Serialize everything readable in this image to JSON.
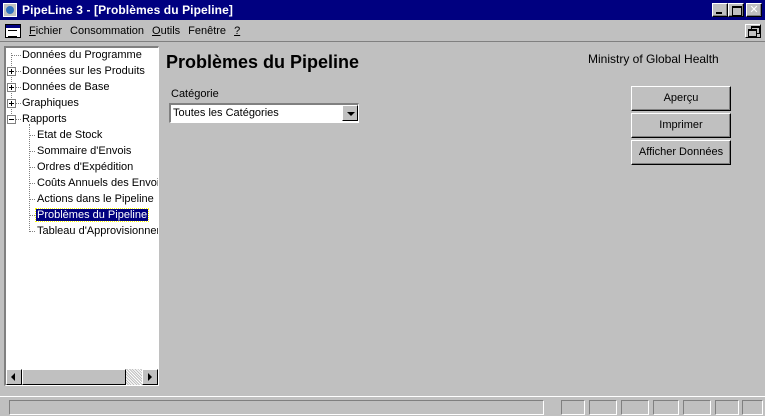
{
  "window": {
    "title": "PipeLine 3 - [Problèmes du Pipeline]"
  },
  "menu": {
    "items": [
      {
        "label": "Fichier",
        "access": "F",
        "rest": "ichier"
      },
      {
        "label": "Consommation",
        "access": "",
        "rest": "Consommation"
      },
      {
        "label": "Outils",
        "access": "O",
        "rest": "utils"
      },
      {
        "label": "Fenêtre",
        "access": "",
        "rest": "Fenêtre"
      },
      {
        "label": "?",
        "access": "?",
        "rest": ""
      }
    ]
  },
  "tree": {
    "items": [
      {
        "label": "Données du Programme",
        "level": 0,
        "expander": "none"
      },
      {
        "label": "Données sur les Produits",
        "level": 0,
        "expander": "plus"
      },
      {
        "label": "Données de Base",
        "level": 0,
        "expander": "plus"
      },
      {
        "label": "Graphiques",
        "level": 0,
        "expander": "plus"
      },
      {
        "label": "Rapports",
        "level": 0,
        "expander": "minus"
      },
      {
        "label": "Etat de Stock",
        "level": 1
      },
      {
        "label": "Sommaire d'Envois",
        "level": 1
      },
      {
        "label": "Ordres d'Expédition",
        "level": 1
      },
      {
        "label": "Coûts Annuels des Envois",
        "level": 1
      },
      {
        "label": "Actions dans le Pipeline",
        "level": 1
      },
      {
        "label": "Problèmes du Pipeline",
        "level": 1,
        "selected": true
      },
      {
        "label": "Tableau d'Approvisionnement",
        "level": 1
      }
    ]
  },
  "main": {
    "title": "Problèmes du Pipeline",
    "organization": "Ministry of Global Health",
    "category_label": "Catégorie",
    "category_value": "Toutes les Catégories"
  },
  "buttons": {
    "preview": "Aperçu",
    "print": "Imprimer",
    "show_data": "Afficher Données"
  },
  "colors": {
    "titlebar": "#000080",
    "face": "#c0c0c0",
    "selection": "#000080"
  }
}
